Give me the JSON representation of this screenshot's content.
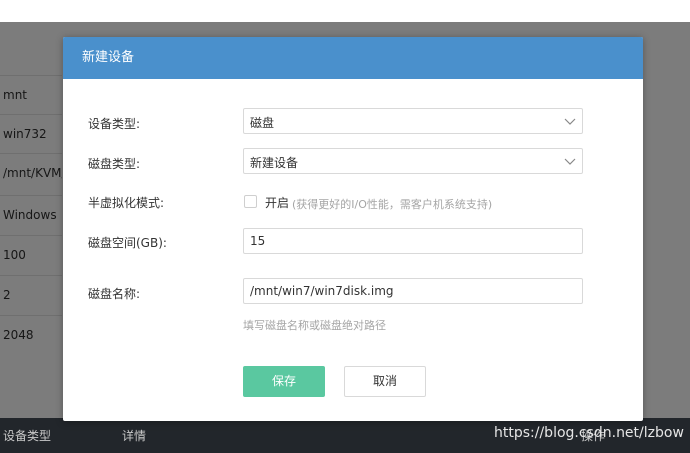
{
  "background": {
    "rows": [
      "mnt",
      "win732",
      "/mnt/KVM/",
      "Windows",
      "100",
      "2",
      "2048"
    ],
    "footer": {
      "col1": "设备类型",
      "col2": "详情",
      "col3": "操作"
    }
  },
  "dialog": {
    "title": "新建设备",
    "device_type": {
      "label": "设备类型:",
      "value": "磁盘"
    },
    "disk_type": {
      "label": "磁盘类型:",
      "value": "新建设备"
    },
    "semi_virtual": {
      "label": "半虚拟化模式:",
      "checkbox_label": "开启",
      "checked": false,
      "hint": "(获得更好的I/O性能，需客户机系统支持)"
    },
    "disk_space": {
      "label": "磁盘空间(GB):",
      "value": "15"
    },
    "disk_name": {
      "label": "磁盘名称:",
      "value": "/mnt/win7/win7disk.img",
      "hint": "填写磁盘名称或磁盘绝对路径"
    },
    "save_label": "保存",
    "cancel_label": "取消"
  },
  "watermark": "https://blog.csdn.net/lzbow",
  "colors": {
    "header": "#4a90cc",
    "save_button": "#5ac8a0"
  },
  "icons": {
    "select_chevron": "chevron-down-icon"
  }
}
